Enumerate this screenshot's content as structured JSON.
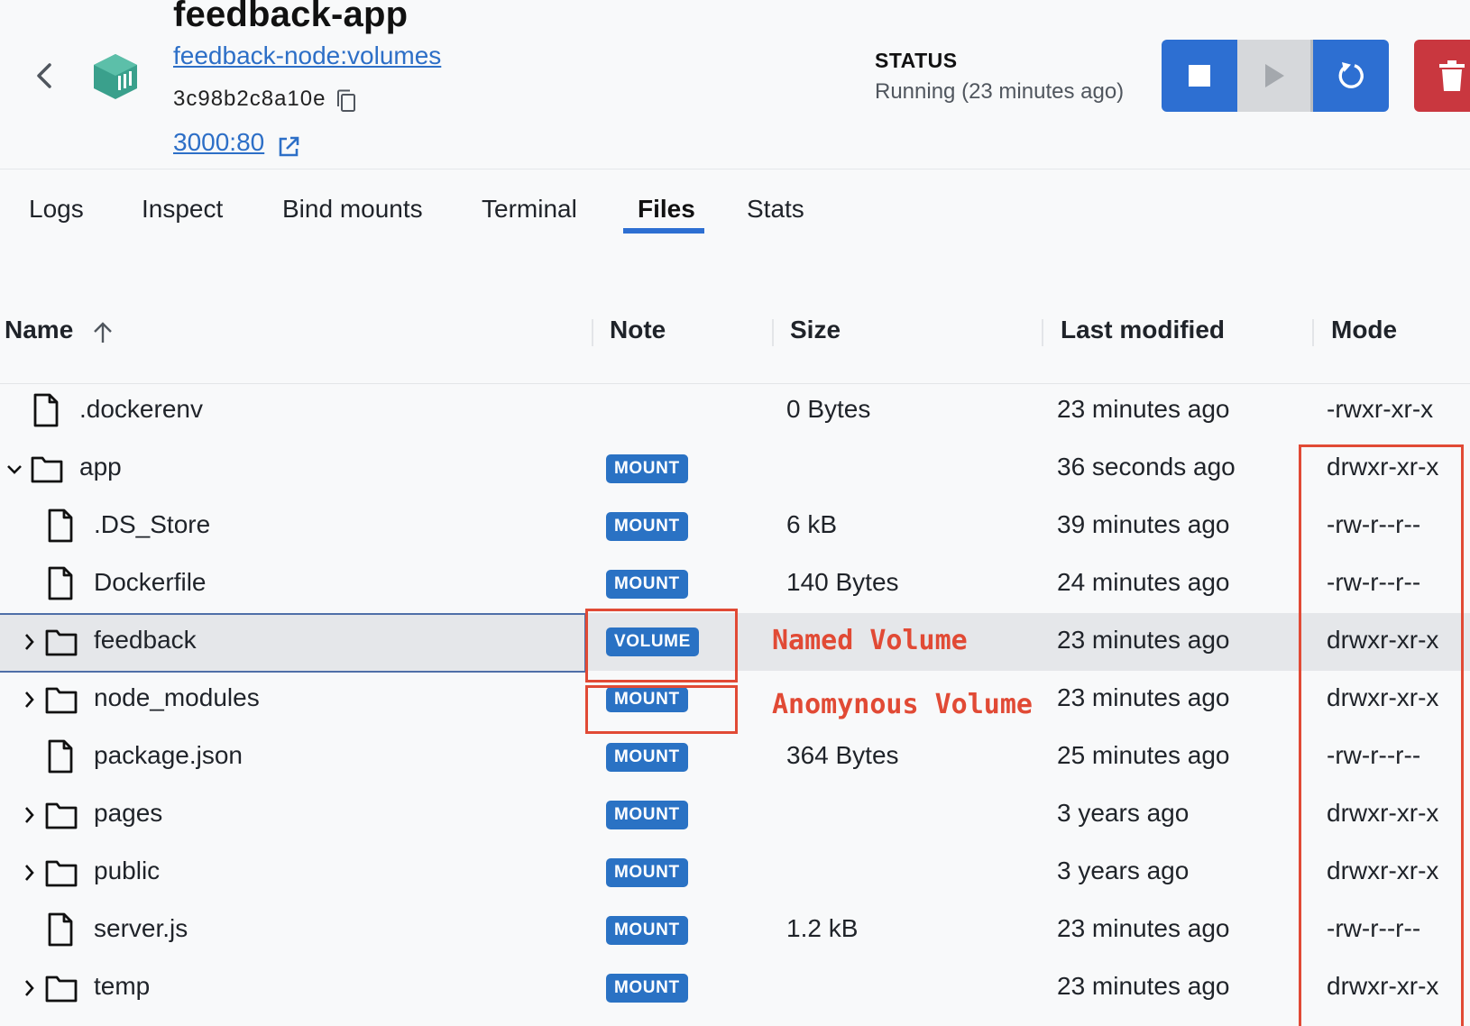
{
  "header": {
    "title": "feedback-app",
    "image_link": "feedback-node:volumes",
    "container_id": "3c98b2c8a10e",
    "port_link": "3000:80",
    "status_label": "STATUS",
    "status_value": "Running (23 minutes ago)"
  },
  "tabs": [
    {
      "label": "Logs"
    },
    {
      "label": "Inspect"
    },
    {
      "label": "Bind mounts"
    },
    {
      "label": "Terminal"
    },
    {
      "label": "Files",
      "active": true
    },
    {
      "label": "Stats"
    }
  ],
  "table": {
    "columns": [
      "Name",
      "Note",
      "Size",
      "Last modified",
      "Mode"
    ],
    "rows": [
      {
        "name": ".dockerenv",
        "type": "file",
        "note": "",
        "size": "0 Bytes",
        "modified": "23 minutes ago",
        "mode": "-rwxr-xr-x"
      },
      {
        "name": "app",
        "type": "folder",
        "expanded": true,
        "note": "MOUNT",
        "size": "",
        "modified": "36 seconds ago",
        "mode": "drwxr-xr-x"
      },
      {
        "name": ".DS_Store",
        "type": "file",
        "note": "MOUNT",
        "size": "6 kB",
        "modified": "39 minutes ago",
        "mode": "-rw-r--r--"
      },
      {
        "name": "Dockerfile",
        "type": "file",
        "note": "MOUNT",
        "size": "140 Bytes",
        "modified": "24 minutes ago",
        "mode": "-rw-r--r--"
      },
      {
        "name": "feedback",
        "type": "folder",
        "selected": true,
        "note": "VOLUME",
        "size": "",
        "modified": "23 minutes ago",
        "mode": "drwxr-xr-x"
      },
      {
        "name": "node_modules",
        "type": "folder",
        "note": "MOUNT",
        "size": "",
        "modified": "23 minutes ago",
        "mode": "drwxr-xr-x"
      },
      {
        "name": "package.json",
        "type": "file",
        "note": "MOUNT",
        "size": "364 Bytes",
        "modified": "25 minutes ago",
        "mode": "-rw-r--r--"
      },
      {
        "name": "pages",
        "type": "folder",
        "note": "MOUNT",
        "size": "",
        "modified": "3 years ago",
        "mode": "drwxr-xr-x"
      },
      {
        "name": "public",
        "type": "folder",
        "note": "MOUNT",
        "size": "",
        "modified": "3 years ago",
        "mode": "drwxr-xr-x"
      },
      {
        "name": "server.js",
        "type": "file",
        "note": "MOUNT",
        "size": "1.2 kB",
        "modified": "23 minutes ago",
        "mode": "-rw-r--r--"
      },
      {
        "name": "temp",
        "type": "folder",
        "note": "MOUNT",
        "size": "",
        "modified": "23 minutes ago",
        "mode": "drwxr-xr-x"
      }
    ]
  },
  "annotations": {
    "named_volume": "Named Volume",
    "anonymous_volume": "Anomynous Volume",
    "color": "#e14a35"
  },
  "colors": {
    "accent": "#2d6fd2",
    "link": "#2d6fc7",
    "badge": "#2a72c4",
    "danger": "#c9373f",
    "container_icon": "#3aa08c"
  },
  "icons": [
    "back-chevron-icon",
    "container-icon",
    "copy-icon",
    "external-link-icon",
    "stop-icon",
    "play-icon",
    "restart-icon",
    "trash-icon",
    "sort-ascending-icon",
    "file-icon",
    "folder-icon",
    "chevron-right-icon",
    "chevron-down-icon"
  ]
}
